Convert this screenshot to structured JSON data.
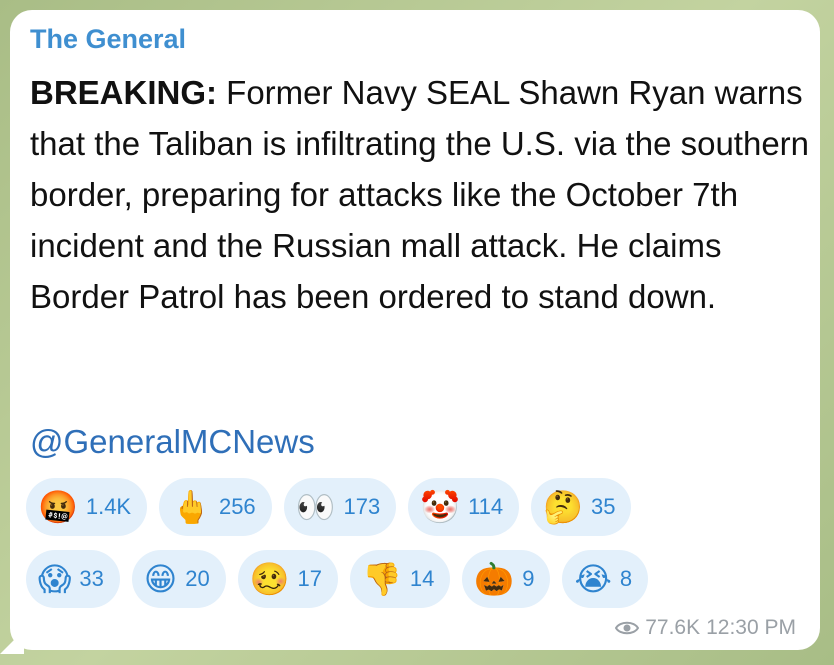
{
  "post": {
    "sender": "The General",
    "lead": "BREAKING:",
    "text": " Former Navy SEAL Shawn Ryan warns that the Taliban is infiltrating the U.S. via the southern border, preparing for attacks like the October 7th incident and the Russian mall attack. He claims Border Patrol has been ordered to stand down.",
    "mention": "@GeneralMCNews"
  },
  "reactions": [
    {
      "icon": "angry-cursing-face-icon",
      "emoji": "🤬",
      "count": "1.4K"
    },
    {
      "icon": "pointing-up-icon",
      "emoji": "🖕",
      "count": "256"
    },
    {
      "icon": "eyes-icon",
      "emoji": "👀",
      "count": "173"
    },
    {
      "icon": "clown-face-icon",
      "emoji": "🤡",
      "count": "114"
    },
    {
      "icon": "thinking-face-icon",
      "emoji": "🤔",
      "count": "35"
    },
    {
      "icon": "screaming-face-icon",
      "emoji": "😱",
      "count": "33"
    },
    {
      "icon": "grinning-face-icon",
      "emoji": "😁",
      "count": "20"
    },
    {
      "icon": "woozy-face-icon",
      "emoji": "🥴",
      "count": "17"
    },
    {
      "icon": "thumbs-down-icon",
      "emoji": "👎",
      "count": "14"
    },
    {
      "icon": "jack-o-lantern-icon",
      "emoji": "🎃",
      "count": "9"
    },
    {
      "icon": "crying-face-icon",
      "emoji": "😭",
      "count": "8"
    }
  ],
  "meta": {
    "views_icon": "eye-icon",
    "views": "77.6K",
    "time": "12:30 PM"
  }
}
